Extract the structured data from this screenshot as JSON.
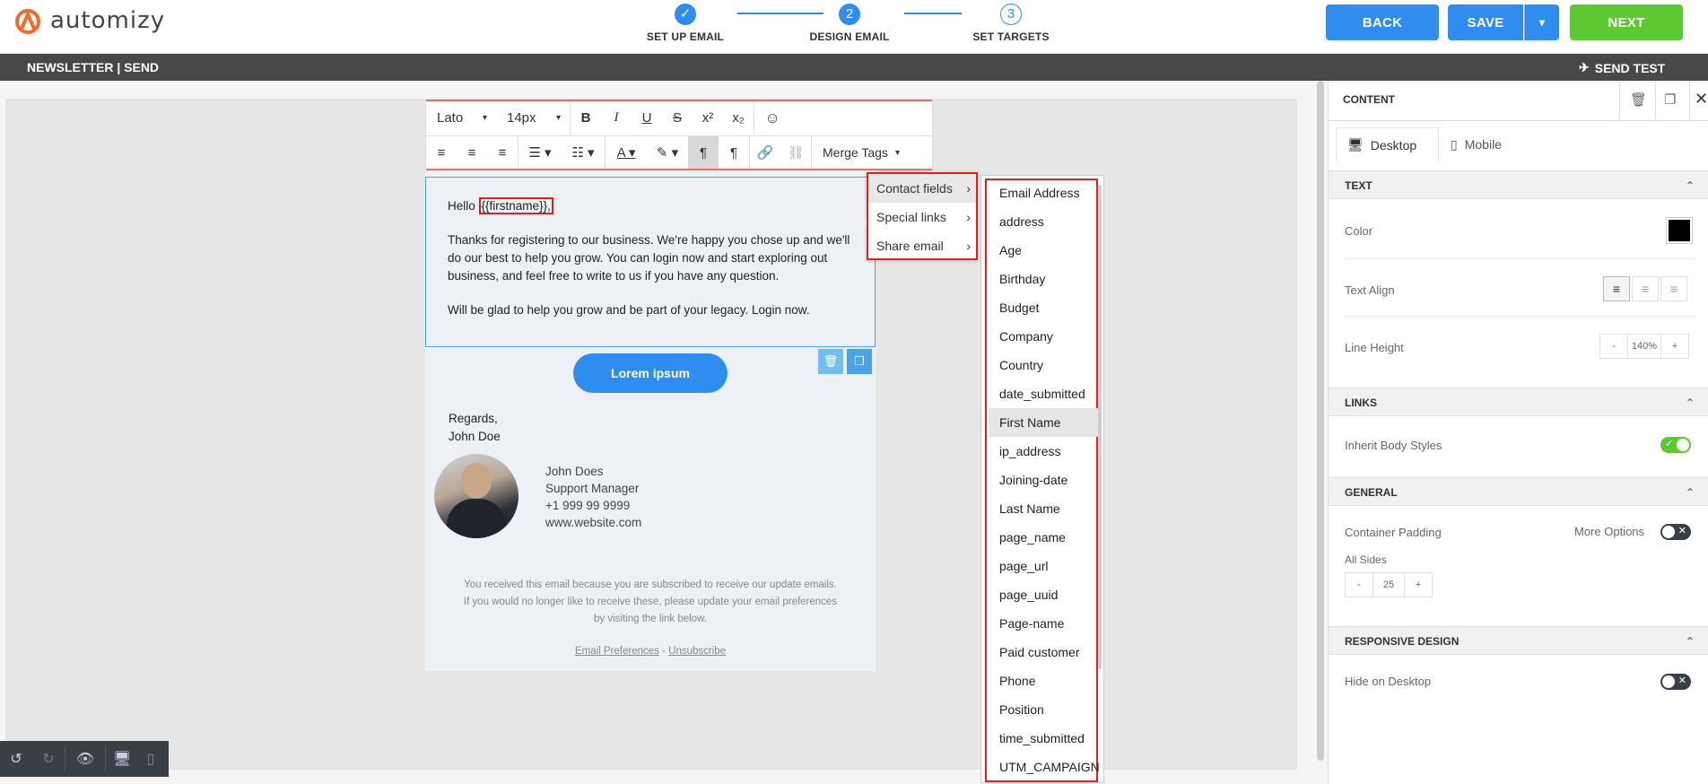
{
  "brand": {
    "name": "automizy",
    "color": "#f26a2e"
  },
  "steps": [
    {
      "num": "✓",
      "label": "SET UP EMAIL"
    },
    {
      "num": "2",
      "label": "DESIGN EMAIL"
    },
    {
      "num": "3",
      "label": "SET TARGETS"
    }
  ],
  "header_buttons": {
    "back": "BACK",
    "save": "SAVE",
    "save_menu": "▾",
    "next": "NEXT"
  },
  "colors": {
    "primary": "#2f8df0",
    "next": "#5dc932",
    "dark": "#484848",
    "highlight": "#e02020"
  },
  "subbar": {
    "title": "NEWSLETTER | SEND",
    "send_test": "SEND TEST"
  },
  "toolbar": {
    "font": "Lato",
    "size": "14px",
    "merge_tags": "Merge Tags"
  },
  "email": {
    "greeting": "Hello",
    "merge_tag": "{{firstname}},",
    "para1": "Thanks for registering to our business. We're happy you chose up and we'll do our best to help you grow. You can login now and start exploring out business, and feel free to write to us if you have any question.",
    "para2": "Will be glad to help you grow and be part of your legacy. Login now.",
    "button": "Lorem ipsum",
    "regards": "Regards,",
    "signer": "John Doe",
    "sig_name": "John Does",
    "sig_title": "Support Manager",
    "sig_phone": "+1 999 99 9999",
    "sig_web": "www.website.com",
    "footer": "You received this email because you are subscribed to receive our update emails. If you would no longer like to receive these, please update your email preferences by visiting the link below.",
    "pref_link": "Email Preferences",
    "dash": " - ",
    "unsub_link": "Unsubscribe"
  },
  "menu1": [
    "Contact fields",
    "Special links",
    "Share email"
  ],
  "menu2": [
    "Email Address",
    "address",
    "Age",
    "Birthday",
    "Budget",
    "Company",
    "Country",
    "date_submitted",
    "First Name",
    "ip_address",
    "Joining-date",
    "Last Name",
    "page_name",
    "page_url",
    "page_uuid",
    "Page-name",
    "Paid customer",
    "Phone",
    "Position",
    "time_submitted",
    "UTM_CAMPAIGN"
  ],
  "menu2_selected": "First Name",
  "panel": {
    "title": "CONTENT",
    "tab_desktop": "Desktop",
    "tab_mobile": "Mobile",
    "sec_text": "TEXT",
    "color_label": "Color",
    "color_value": "#000000",
    "align_label": "Text Align",
    "lh_label": "Line Height",
    "lh_minus": "-",
    "lh_value": "140%",
    "lh_plus": "+",
    "sec_links": "LINKS",
    "inherit_label": "Inherit Body Styles",
    "sec_general": "GENERAL",
    "padding_label": "Container Padding",
    "more_options": "More Options",
    "all_sides": "All Sides",
    "pad_minus": "-",
    "pad_value": "25",
    "pad_plus": "+",
    "sec_responsive": "RESPONSIVE DESIGN",
    "hide_desktop": "Hide on Desktop"
  }
}
